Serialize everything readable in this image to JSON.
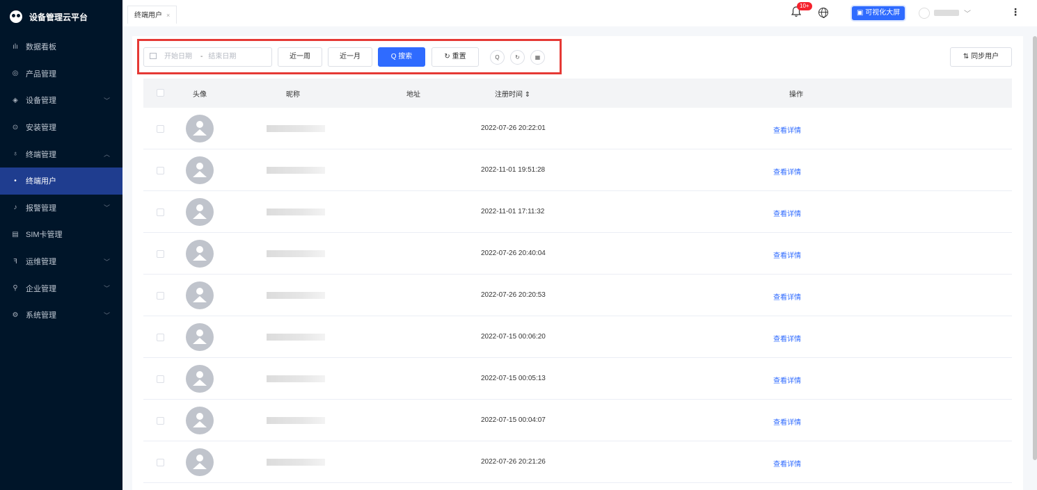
{
  "app": {
    "title": "设备管理云平台"
  },
  "sidebar": {
    "items": [
      {
        "label": "数据看板",
        "icon": "bar-chart-icon",
        "glyph": "ılı",
        "arrow": ""
      },
      {
        "label": "产品管理",
        "icon": "cube-icon",
        "glyph": "◎",
        "arrow": ""
      },
      {
        "label": "设备管理",
        "icon": "device-icon",
        "glyph": "◈",
        "arrow": "﹀"
      },
      {
        "label": "安装管理",
        "icon": "install-icon",
        "glyph": "⊙",
        "arrow": ""
      },
      {
        "label": "终端管理",
        "icon": "user-icon",
        "glyph": "♁",
        "arrow": "︿"
      },
      {
        "label": "终端用户",
        "icon": "dot-icon",
        "glyph": "•",
        "arrow": ""
      },
      {
        "label": "报警管理",
        "icon": "alarm-icon",
        "glyph": "♪",
        "arrow": "﹀"
      },
      {
        "label": "SIM卡管理",
        "icon": "sim-card-icon",
        "glyph": "▤",
        "arrow": ""
      },
      {
        "label": "运维管理",
        "icon": "ops-icon",
        "glyph": "ꟻ",
        "arrow": "﹀"
      },
      {
        "label": "企业管理",
        "icon": "company-icon",
        "glyph": "⚲",
        "arrow": "﹀"
      },
      {
        "label": "系统管理",
        "icon": "settings-icon",
        "glyph": "⚙",
        "arrow": "﹀"
      }
    ]
  },
  "topbar": {
    "tab_label": "终端用户",
    "tab_close": "×",
    "notification_badge": "10+",
    "screen_button": "▣ 可视化大屏",
    "user_caret": "﹀",
    "more": "⋮"
  },
  "toolbar": {
    "start_placeholder": "开始日期",
    "range_separator": "-",
    "end_placeholder": "结束日期",
    "last_week": "近一周",
    "last_month": "近一月",
    "search": "Q 搜索",
    "reset": "↻ 重置",
    "circle_search": "Q",
    "circle_refresh": "↻",
    "circle_columns": "▦",
    "sync_users": "⇅ 同步用户"
  },
  "table": {
    "headers": {
      "avatar": "头像",
      "nickname": "昵称",
      "address": "地址",
      "register_time": "注册时间 ⇕",
      "actions": "操作"
    },
    "rows": [
      {
        "time": "2022-07-26 20:22:01",
        "action": "查看详情"
      },
      {
        "time": "2022-11-01 19:51:28",
        "action": "查看详情"
      },
      {
        "time": "2022-11-01 17:11:32",
        "action": "查看详情"
      },
      {
        "time": "2022-07-26 20:40:04",
        "action": "查看详情"
      },
      {
        "time": "2022-07-26 20:20:53",
        "action": "查看详情"
      },
      {
        "time": "2022-07-15 00:06:20",
        "action": "查看详情"
      },
      {
        "time": "2022-07-15 00:05:13",
        "action": "查看详情"
      },
      {
        "time": "2022-07-15 00:04:07",
        "action": "查看详情"
      },
      {
        "time": "2022-07-26 20:21:26",
        "action": "查看详情"
      }
    ]
  },
  "colors": {
    "primary": "#2f6bff",
    "sidebar_bg": "#001529",
    "active_menu": "#1f3d8f",
    "highlight": "#e53935"
  }
}
